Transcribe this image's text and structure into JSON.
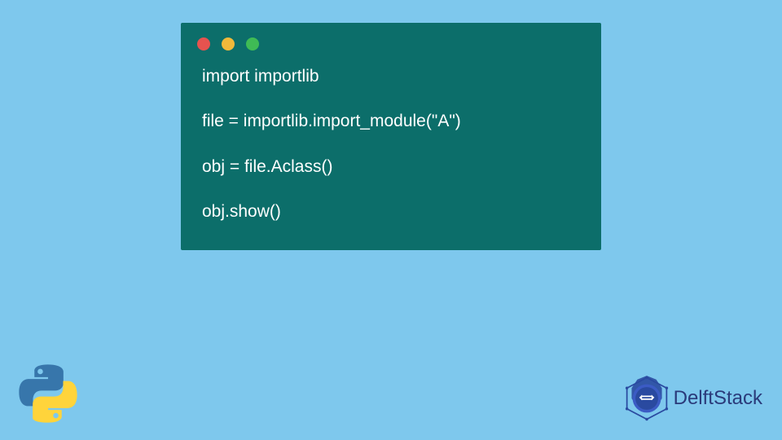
{
  "code": {
    "line1": "import importlib",
    "line2": "file = importlib.import_module(\"A\")",
    "line3": "obj = file.Aclass()",
    "line4": "obj.show()"
  },
  "brand": {
    "name": "DelftStack"
  },
  "colors": {
    "page_bg": "#7ec8ed",
    "window_bg": "#0c6e6a",
    "code_text": "#ffffff",
    "dot_red": "#e6534f",
    "dot_yellow": "#f0b93a",
    "dot_green": "#3fbb55",
    "brand_text": "#2a3a7a"
  }
}
